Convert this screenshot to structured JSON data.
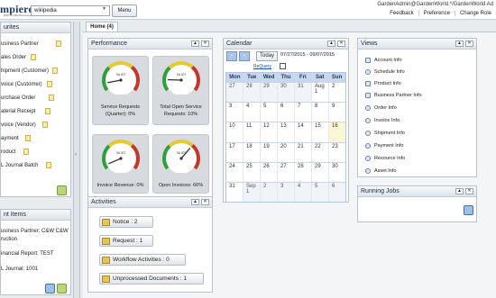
{
  "header": {
    "logo": "mpiere",
    "logo_sub": "ERP & CRM Business Solution",
    "search_value": "wikipedia",
    "menu_label": "Menu",
    "user": "GardenAdmin@GardenWorld.*/GardenWorld Ad",
    "links": [
      "Feedback",
      "Preference",
      "Change Role"
    ]
  },
  "favourites": {
    "title": "urites",
    "items": [
      "usiness Partner",
      "ales Order",
      "hipment (Customer)",
      "voice (Customer)",
      "urchase Order",
      "aterial Receipt",
      "voice (Vendor)",
      "ayment",
      "roduct",
      "L Journal Batch"
    ]
  },
  "recent": {
    "title": "nt Items",
    "items": [
      "usiness Partner: C&W C&W",
      "ruction",
      "inancial Report: TEST",
      "L Journal: 1001"
    ]
  },
  "tabs": [
    "Home (4)"
  ],
  "performance": {
    "title": "Performance",
    "gauges": [
      {
        "label_1": "Service Requests",
        "label_2": "(Quarter): 0%",
        "value": 0.1,
        "scale_label": "SA 007"
      },
      {
        "label_1": "Total Open Service",
        "label_2": "Requests: 10%",
        "value": 0.15,
        "scale_label": "SA 007"
      },
      {
        "label_1": "Invoice Revenue: 0%",
        "label_2": "",
        "value": 0.05,
        "scale_label": "SA 007"
      },
      {
        "label_1": "Open Invoices: 66%",
        "label_2": "",
        "value": 0.66,
        "scale_label": "SA 007"
      }
    ]
  },
  "activities": {
    "title": "Activities",
    "buttons": [
      "Notice : 2",
      "Request : 1",
      "Workflow Activities : 0",
      "Unprocessed Documents : 1"
    ]
  },
  "calendar": {
    "title": "Calendar",
    "today_label": "Today",
    "range": "07/27/2015 - 09/07/2015",
    "requery": "ReQuery",
    "days": [
      "Mon",
      "Tue",
      "Wed",
      "Thu",
      "Fri",
      "Sat",
      "Sun"
    ],
    "weeks": [
      [
        "27",
        "28",
        "29",
        "30",
        "31",
        "Aug 1",
        "2"
      ],
      [
        "3",
        "4",
        "5",
        "6",
        "7",
        "8",
        "9"
      ],
      [
        "10",
        "11",
        "12",
        "13",
        "14",
        "15",
        "16"
      ],
      [
        "17",
        "18",
        "19",
        "20",
        "21",
        "22",
        "23"
      ],
      [
        "24",
        "25",
        "26",
        "27",
        "28",
        "29",
        "30"
      ],
      [
        "31",
        "Sep 1",
        "2",
        "3",
        "4",
        "5",
        "6"
      ]
    ]
  },
  "views": {
    "title": "Views",
    "items": [
      "Account Info",
      "Schedule Info",
      "Product Info",
      "Business Partner Info",
      "Order Info",
      "Invoice Info",
      "Shipment Info",
      "Payment Info",
      "Resource Info",
      "Asset Info"
    ]
  },
  "jobs": {
    "title": "Running Jobs"
  }
}
